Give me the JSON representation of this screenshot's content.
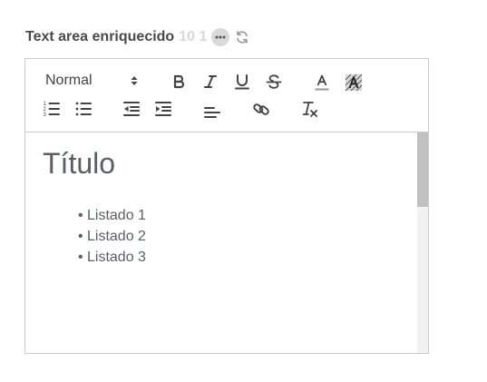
{
  "field": {
    "label": "Text area enriquecido",
    "counter": "10 1"
  },
  "toolbar": {
    "header_select_value": "Normal",
    "icons": {
      "header_arrow": "up-down-arrows-icon",
      "bold": "bold-icon",
      "italic": "italic-icon",
      "underline": "underline-icon",
      "strike": "strikethrough-icon",
      "color": "text-color-icon",
      "background": "background-color-icon",
      "ordered_list": "ordered-list-icon",
      "bullet_list": "bullet-list-icon",
      "outdent": "outdent-icon",
      "indent": "indent-icon",
      "align": "align-left-icon",
      "link": "link-icon",
      "clean": "clear-formatting-icon"
    }
  },
  "content": {
    "title": "Título",
    "bullet": "•",
    "list_items": [
      "Listado 1",
      "Listado 2",
      "Listado 3"
    ]
  },
  "colors": {
    "label": "#4a4a4a",
    "counter": "#d8d8d8",
    "icon": "#444444",
    "text": "#5a5e66",
    "border": "#cccccc"
  }
}
